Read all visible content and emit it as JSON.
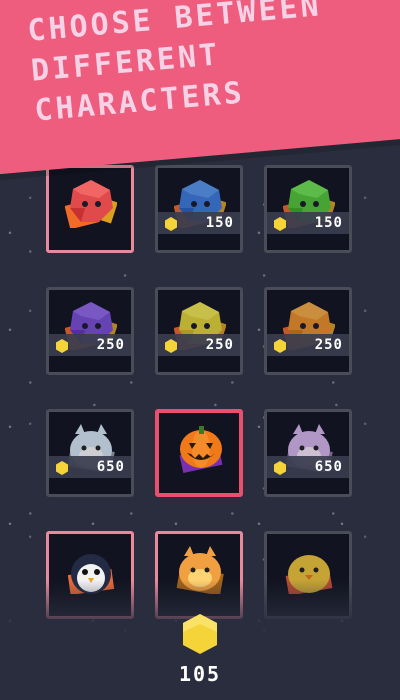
{
  "banner": {
    "lines": [
      "CHOOSE BETWEEN",
      "DIFFERENT",
      "CHARACTERS"
    ]
  },
  "characters": [
    {
      "name": "red-blob",
      "state": "unlocked",
      "color": "#e04a4a",
      "price": ""
    },
    {
      "name": "blue-blob",
      "state": "locked",
      "color": "#3f7de0",
      "price": "150"
    },
    {
      "name": "green-blob",
      "state": "locked",
      "color": "#55c93a",
      "price": "150"
    },
    {
      "name": "purple-blob",
      "state": "locked",
      "color": "#7a4fd8",
      "price": "250"
    },
    {
      "name": "yellow-blob",
      "state": "locked",
      "color": "#e6d63a",
      "price": "250"
    },
    {
      "name": "orange-blob",
      "state": "locked",
      "color": "#f0922a",
      "price": "250"
    },
    {
      "name": "snow-yeti",
      "state": "locked",
      "color": "#d9ecf7",
      "price": "650"
    },
    {
      "name": "pumpkin",
      "state": "selected",
      "color": "#f07a1a",
      "price": ""
    },
    {
      "name": "lilac-cat",
      "state": "locked",
      "color": "#d8b8f0",
      "price": "650"
    },
    {
      "name": "penguin",
      "state": "unlocked",
      "color": "#222a44",
      "price": ""
    },
    {
      "name": "hamster",
      "state": "unlocked",
      "color": "#f0a040",
      "price": ""
    },
    {
      "name": "chick",
      "state": "locked",
      "color": "#f2c83a",
      "price": ""
    }
  ],
  "wallet": {
    "coins": "105",
    "coin_color": "#f5d43a"
  }
}
